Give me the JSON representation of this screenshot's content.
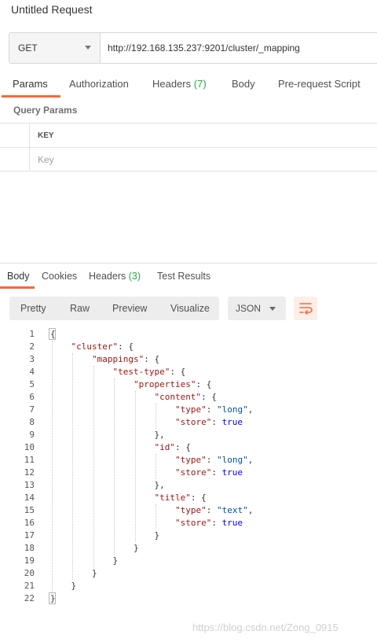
{
  "window": {
    "title": "Untitled Request"
  },
  "request": {
    "method": "GET",
    "url": "http://192.168.135.237:9201/cluster/_mapping"
  },
  "tabs": [
    {
      "label": "Params",
      "count": ""
    },
    {
      "label": "Authorization",
      "count": ""
    },
    {
      "label": "Headers",
      "count": "(7)"
    },
    {
      "label": "Body",
      "count": ""
    },
    {
      "label": "Pre-request Script",
      "count": ""
    }
  ],
  "params": {
    "section_title": "Query Params",
    "column_key": "KEY",
    "key_placeholder": "Key"
  },
  "response": {
    "tabs": [
      {
        "label": "Body",
        "count": ""
      },
      {
        "label": "Cookies",
        "count": ""
      },
      {
        "label": "Headers",
        "count": "(3)"
      },
      {
        "label": "Test Results",
        "count": ""
      }
    ],
    "views": [
      "Pretty",
      "Raw",
      "Preview",
      "Visualize"
    ],
    "language": "JSON",
    "lines": [
      {
        "n": "1",
        "tokens": [
          {
            "t": "p",
            "v": "{"
          }
        ]
      },
      {
        "n": "2",
        "tokens": [
          {
            "t": "p",
            "v": "    "
          },
          {
            "t": "k",
            "v": "\"cluster\""
          },
          {
            "t": "p",
            "v": ": {"
          }
        ]
      },
      {
        "n": "3",
        "tokens": [
          {
            "t": "p",
            "v": "        "
          },
          {
            "t": "k",
            "v": "\"mappings\""
          },
          {
            "t": "p",
            "v": ": {"
          }
        ]
      },
      {
        "n": "4",
        "tokens": [
          {
            "t": "p",
            "v": "            "
          },
          {
            "t": "k",
            "v": "\"test-type\""
          },
          {
            "t": "p",
            "v": ": {"
          }
        ]
      },
      {
        "n": "5",
        "tokens": [
          {
            "t": "p",
            "v": "                "
          },
          {
            "t": "k",
            "v": "\"properties\""
          },
          {
            "t": "p",
            "v": ": {"
          }
        ]
      },
      {
        "n": "6",
        "tokens": [
          {
            "t": "p",
            "v": "                    "
          },
          {
            "t": "k",
            "v": "\"content\""
          },
          {
            "t": "p",
            "v": ": {"
          }
        ]
      },
      {
        "n": "7",
        "tokens": [
          {
            "t": "p",
            "v": "                        "
          },
          {
            "t": "k",
            "v": "\"type\""
          },
          {
            "t": "p",
            "v": ": "
          },
          {
            "t": "s",
            "v": "\"long\""
          },
          {
            "t": "p",
            "v": ","
          }
        ]
      },
      {
        "n": "8",
        "tokens": [
          {
            "t": "p",
            "v": "                        "
          },
          {
            "t": "k",
            "v": "\"store\""
          },
          {
            "t": "p",
            "v": ": "
          },
          {
            "t": "b",
            "v": "true"
          }
        ]
      },
      {
        "n": "9",
        "tokens": [
          {
            "t": "p",
            "v": "                    },"
          }
        ]
      },
      {
        "n": "10",
        "tokens": [
          {
            "t": "p",
            "v": "                    "
          },
          {
            "t": "k",
            "v": "\"id\""
          },
          {
            "t": "p",
            "v": ": {"
          }
        ]
      },
      {
        "n": "11",
        "tokens": [
          {
            "t": "p",
            "v": "                        "
          },
          {
            "t": "k",
            "v": "\"type\""
          },
          {
            "t": "p",
            "v": ": "
          },
          {
            "t": "s",
            "v": "\"long\""
          },
          {
            "t": "p",
            "v": ","
          }
        ]
      },
      {
        "n": "12",
        "tokens": [
          {
            "t": "p",
            "v": "                        "
          },
          {
            "t": "k",
            "v": "\"store\""
          },
          {
            "t": "p",
            "v": ": "
          },
          {
            "t": "b",
            "v": "true"
          }
        ]
      },
      {
        "n": "13",
        "tokens": [
          {
            "t": "p",
            "v": "                    },"
          }
        ]
      },
      {
        "n": "14",
        "tokens": [
          {
            "t": "p",
            "v": "                    "
          },
          {
            "t": "k",
            "v": "\"title\""
          },
          {
            "t": "p",
            "v": ": {"
          }
        ]
      },
      {
        "n": "15",
        "tokens": [
          {
            "t": "p",
            "v": "                        "
          },
          {
            "t": "k",
            "v": "\"type\""
          },
          {
            "t": "p",
            "v": ": "
          },
          {
            "t": "s",
            "v": "\"text\""
          },
          {
            "t": "p",
            "v": ","
          }
        ]
      },
      {
        "n": "16",
        "tokens": [
          {
            "t": "p",
            "v": "                        "
          },
          {
            "t": "k",
            "v": "\"store\""
          },
          {
            "t": "p",
            "v": ": "
          },
          {
            "t": "b",
            "v": "true"
          }
        ]
      },
      {
        "n": "17",
        "tokens": [
          {
            "t": "p",
            "v": "                    }"
          }
        ]
      },
      {
        "n": "18",
        "tokens": [
          {
            "t": "p",
            "v": "                }"
          }
        ]
      },
      {
        "n": "19",
        "tokens": [
          {
            "t": "p",
            "v": "            }"
          }
        ]
      },
      {
        "n": "20",
        "tokens": [
          {
            "t": "p",
            "v": "        }"
          }
        ]
      },
      {
        "n": "21",
        "tokens": [
          {
            "t": "p",
            "v": "    }"
          }
        ]
      },
      {
        "n": "22",
        "tokens": [
          {
            "t": "p",
            "v": "}"
          }
        ]
      }
    ]
  },
  "watermark": "https://blog.csdn.net/Zong_0915",
  "icons": {
    "method_dropdown": "chevron-down-icon",
    "language_dropdown": "chevron-down-icon",
    "wrap": "wrap-lines-icon"
  },
  "colors": {
    "accent": "#f26b3a",
    "count": "#28a745",
    "json_key": "#a31515",
    "json_string": "#0451a5",
    "json_bool": "#0000ff"
  }
}
